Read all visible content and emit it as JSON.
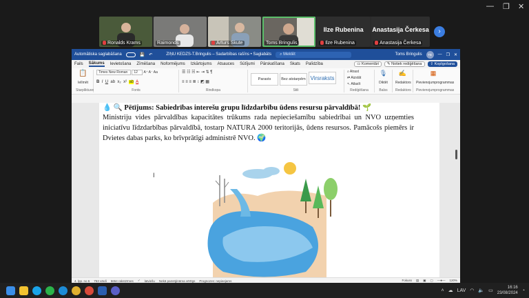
{
  "meeting": {
    "participants": [
      {
        "name": "Ronalds Krams",
        "muted": true,
        "video": true,
        "bg": "#4a5a3a"
      },
      {
        "name": "Raimonds",
        "muted": false,
        "video": true,
        "bg": "#7a7a78"
      },
      {
        "name": "Arturs Skute",
        "muted": true,
        "video": true,
        "bg": "#8a8c86"
      },
      {
        "name": "Toms Bringulis",
        "muted": false,
        "video": true,
        "bg": "#6a6660",
        "active": true
      },
      {
        "name": "Ilze Rubenina",
        "muted": true,
        "video": false,
        "bg": "#3a3a3a"
      },
      {
        "name": "Anastasija Čerkesa",
        "muted": true,
        "video": false,
        "bg": "#3a3a3a"
      }
    ],
    "next_icon": "chevron-right-icon"
  },
  "word": {
    "autosave_label": "Automātiska saglabāšana",
    "doc_title": "ZIŅU KEDZS-T.Bringulis – Sadarbības rašīns • Saglabāts",
    "search_placeholder": "Meklēt",
    "user_name": "Toms Bringulis",
    "user_initials": "TB",
    "menus": [
      "Fails",
      "Sākums",
      "Ievietošana",
      "Zīmēšana",
      "Noformējums",
      "Izkārtojums",
      "Atsauces",
      "Sūtījumi",
      "Pārskatīšana",
      "Skats",
      "Palīdzība"
    ],
    "active_menu": "Sākums",
    "comments_label": "Komentāri",
    "editing_label": "Notiek rediģēšana",
    "share_label": "Kopīgošana",
    "ribbon": {
      "paste_label": "Ielīmēt",
      "clipboard_group": "Starpliktuve",
      "font_name": "Times New Roman",
      "font_size": "12",
      "font_group": "Fonts",
      "paragraph_group": "Rindkopa",
      "styles": [
        "Parasts",
        "Bez atstarpēm",
        "Virsraksts"
      ],
      "styles_group": "Stili",
      "find_label": "Atrast",
      "replace_label": "Aizstāt",
      "select_label": "Atlasīt",
      "editing_group": "Rediģēšana",
      "dictate_label": "Diktēt",
      "voice_group": "Balss",
      "editor_label": "Redaktors",
      "editor_group": "Redaktors",
      "addins_label": "Pievienojumprogrammas",
      "addins_group": "Pievienojumprogrammas"
    },
    "document": {
      "heading": "Pētījums: Sabiedrības interešu grupu līdzdarbību ūdens resursu pārvaldībā!",
      "paragraph": "Ministriju vides pārvaldības kapacitātes trūkums rada nepieciešamību sabiedrībai un NVO uzņemties iniciatīvu līdzdarbības pārvaldībā, tostarp NATURA 2000 teritorijās, ūdens resursos. Pamācošs piemērs ir Dvietes dabas parks, ko brīvprātīgi administrē NVO."
    },
    "status": {
      "page": "4. lpp. no 6",
      "words": "753 vārdi",
      "chars": "5654 rakstzīmes",
      "language": "latviešu",
      "accessibility": "Nekā pamēģināma vērtīgs",
      "predictions": "Prognozes: nepieejams",
      "focus": "Fokuss",
      "zoom": "120%"
    }
  },
  "taskbar": {
    "lang": "LAV",
    "time": "16:16",
    "date": "23/08/2024"
  }
}
